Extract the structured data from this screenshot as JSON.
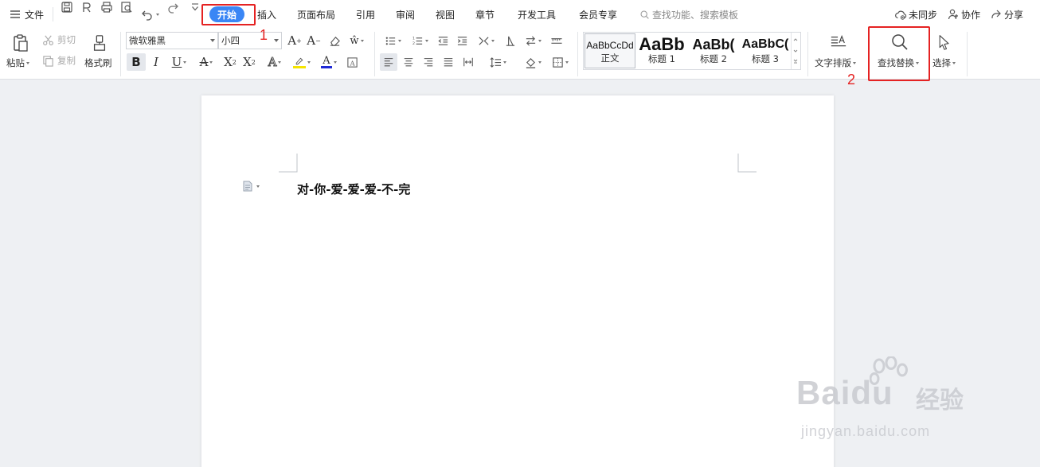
{
  "menu": {
    "file_label": "文件",
    "tabs": [
      {
        "label": "开始",
        "active": true
      },
      {
        "label": "插入"
      },
      {
        "label": "页面布局"
      },
      {
        "label": "引用"
      },
      {
        "label": "审阅"
      },
      {
        "label": "视图"
      },
      {
        "label": "章节"
      },
      {
        "label": "开发工具"
      },
      {
        "label": "会员专享"
      }
    ],
    "search_placeholder": "查找功能、搜索模板",
    "right": {
      "sync_label": "未同步",
      "collab_label": "协作",
      "share_label": "分享"
    },
    "active_tab_color": "#3a86f5"
  },
  "ribbon": {
    "clipboard": {
      "paste_label": "粘贴",
      "cut_label": "剪切",
      "copy_label": "复制",
      "format_painter_label": "格式刷"
    },
    "font": {
      "font_name": "微软雅黑",
      "font_size": "小四"
    },
    "styles": [
      {
        "sample": "AaBbCcDd",
        "name": "正文"
      },
      {
        "sample": "AaBb",
        "name": "标题 1"
      },
      {
        "sample": "AaBb(",
        "name": "标题 2"
      },
      {
        "sample": "AaBbC(",
        "name": "标题 3"
      }
    ],
    "text_layout_label": "文字排版",
    "find_replace_label": "查找替换",
    "select_label": "选择"
  },
  "annotations": {
    "step1": "1",
    "step2": "2",
    "color": "#e52222"
  },
  "document": {
    "text": "对-你-爱-爱-爱-不-完"
  },
  "watermark": {
    "brand": "Baidu",
    "cn": "经验",
    "url": "jingyan.baidu.com"
  }
}
